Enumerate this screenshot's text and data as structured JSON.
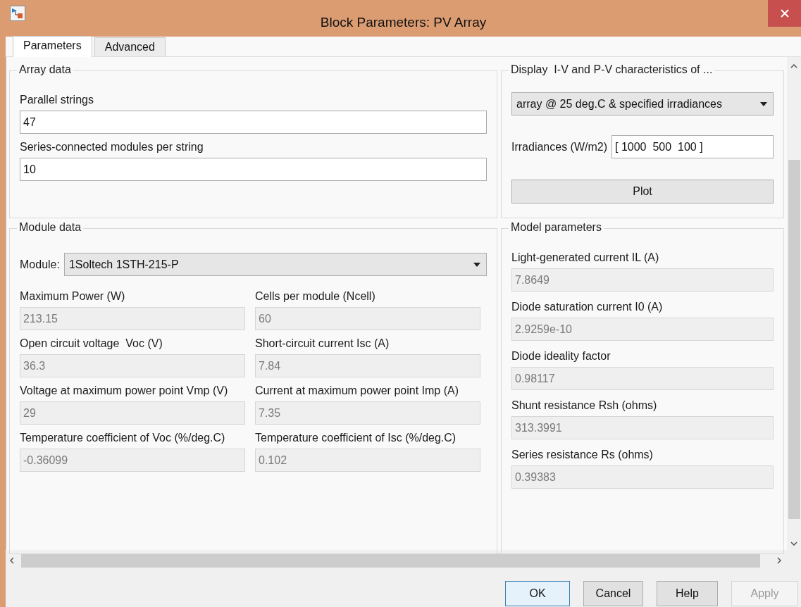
{
  "window": {
    "title": "Block Parameters: PV Array"
  },
  "tabs": [
    {
      "label": "Parameters",
      "selected": true
    },
    {
      "label": "Advanced",
      "selected": false
    }
  ],
  "array_data": {
    "title": "Array data",
    "fields": [
      {
        "label": "Parallel strings",
        "value": "47",
        "disabled": false
      },
      {
        "label": "Series-connected modules per string",
        "value": "10",
        "disabled": false
      }
    ]
  },
  "display": {
    "title": "Display  I-V and P-V characteristics of ...",
    "dropdown": "array @ 25 deg.C & specified irradiances",
    "irradiances": {
      "label": "Irradiances (W/m2)",
      "value": "[ 1000  500  100 ]"
    },
    "plot_button": "Plot"
  },
  "module_data": {
    "title": "Module data",
    "module": {
      "label": "Module:",
      "value": "1Soltech 1STH-215-P"
    },
    "fields": [
      {
        "label": "Maximum Power (W)",
        "value": "213.15",
        "disabled": true
      },
      {
        "label": "Cells per module (Ncell)",
        "value": "60",
        "disabled": true
      },
      {
        "label": "Open circuit voltage  Voc (V)",
        "value": "36.3",
        "disabled": true
      },
      {
        "label": "Short-circuit current Isc (A)",
        "value": "7.84",
        "disabled": true
      },
      {
        "label": "Voltage at maximum power point Vmp (V)",
        "value": "29",
        "disabled": true
      },
      {
        "label": "Current at maximum power point Imp (A)",
        "value": "7.35",
        "disabled": true
      },
      {
        "label": "Temperature coefficient of Voc (%/deg.C)",
        "value": "-0.36099",
        "disabled": true
      },
      {
        "label": "Temperature coefficient of Isc (%/deg.C)",
        "value": "0.102",
        "disabled": true
      }
    ]
  },
  "model_parameters": {
    "title": "Model parameters",
    "fields": [
      {
        "label": "Light-generated current IL (A)",
        "value": "7.8649",
        "disabled": true
      },
      {
        "label": "Diode saturation current I0 (A)",
        "value": "2.9259e-10",
        "disabled": true
      },
      {
        "label": "Diode ideality factor",
        "value": "0.98117",
        "disabled": true
      },
      {
        "label": "Shunt resistance Rsh (ohms)",
        "value": "313.3991",
        "disabled": true
      },
      {
        "label": "Series resistance Rs (ohms)",
        "value": "0.39383",
        "disabled": true
      }
    ]
  },
  "buttons": [
    {
      "label": "OK",
      "default": true,
      "disabled": false
    },
    {
      "label": "Cancel",
      "default": false,
      "disabled": false
    },
    {
      "label": "Help",
      "default": false,
      "disabled": false
    },
    {
      "label": "Apply",
      "default": false,
      "disabled": true
    }
  ]
}
